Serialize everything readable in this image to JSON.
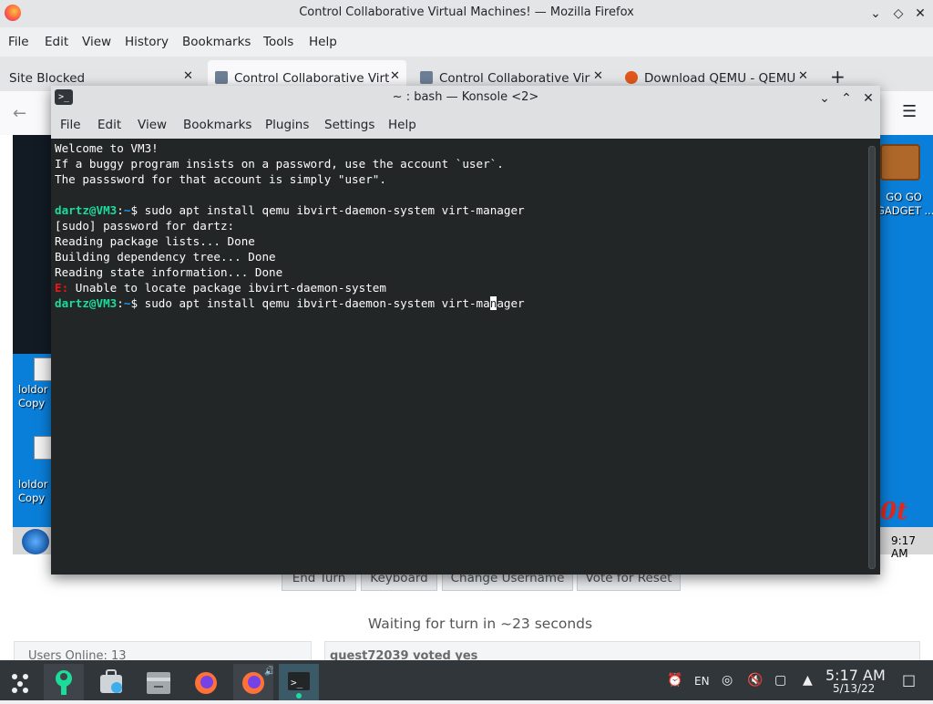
{
  "firefox": {
    "window_title": "Control Collaborative Virtual Machines! — Mozilla Firefox",
    "menu": [
      "File",
      "Edit",
      "View",
      "History",
      "Bookmarks",
      "Tools",
      "Help"
    ],
    "tabs": [
      {
        "label": "Site Blocked"
      },
      {
        "label": "Control Collaborative Virtua"
      },
      {
        "label": "Control Collaborative Virtu"
      },
      {
        "label": "Download QEMU - QEMU"
      }
    ],
    "new_tab": "+",
    "close_tab": "✕"
  },
  "page": {
    "vm_desktop": {
      "icon_label_1": "GO GO\nGADGET ...",
      "icon_label_2": "loldor\nCopy",
      "icon_label_3": "loldor\nCopy",
      "clock": "9:17 AM",
      "red_text": "0t"
    },
    "buttons": [
      "End Turn",
      "Keyboard",
      "Change Username",
      "Vote for Reset"
    ],
    "waiting": "Waiting for turn in ~23 seconds",
    "users_online": "Users Online: 13",
    "chat_partial": "guest72039 voted yes"
  },
  "konsole": {
    "title": "~ : bash — Konsole <2>",
    "menu": [
      "File",
      "Edit",
      "View",
      "Bookmarks",
      "Plugins",
      "Settings",
      "Help"
    ],
    "lines": {
      "l1": "Welcome to VM3!",
      "l2": "If a buggy program insists on a password, use the account `user`.",
      "l3": "The passsword for that account is simply \"user\".",
      "prompt_user": "dartz@VM3",
      "prompt_path": "~",
      "cmd1": " sudo apt install qemu ibvirt-daemon-system virt-manager",
      "l5": "[sudo] password for dartz:",
      "l6": "Reading package lists... Done",
      "l7": "Building dependency tree... Done",
      "l8": "Reading state information... Done",
      "err_tag": "E:",
      "err_msg": " Unable to locate package ibvirt-daemon-system",
      "cmd2_before": " sudo apt install qemu ibvirt-daemon-system virt-ma",
      "cmd2_cursor": "n",
      "cmd2_after": "ager"
    }
  },
  "taskbar": {
    "keyboard_layout": "EN",
    "time": "5:17 AM",
    "date": "5/13/22"
  },
  "colors": {
    "terminal_bg": "#232627",
    "prompt_green": "#1cdc9a",
    "path_blue": "#1d99f3",
    "error_red": "#ed1515",
    "taskbar_bg": "#31363b"
  }
}
